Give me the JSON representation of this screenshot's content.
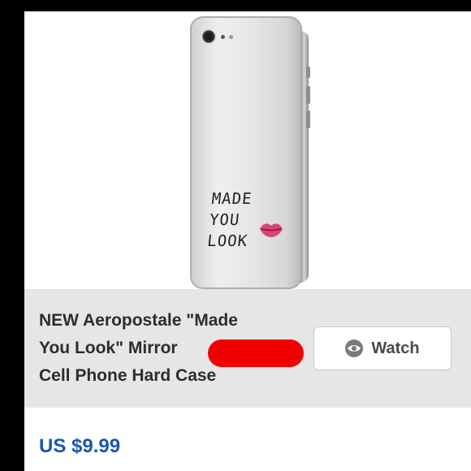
{
  "listing": {
    "title": "NEW Aeropostale \"Made You Look\" Mirror Cell Phone Hard Case",
    "title_lines": [
      "NEW Aeropostale \"Made",
      "You Look\" Mirror",
      "Cell Phone Hard Case"
    ],
    "watch_label": "Watch",
    "price": "US $9.99"
  },
  "product_image": {
    "case_text": [
      "MADE",
      "YOU",
      "LOOK"
    ]
  },
  "colors": {
    "price": "#1b55b5",
    "redaction": "#f20000"
  },
  "icons": {
    "watch": "eye-icon"
  }
}
